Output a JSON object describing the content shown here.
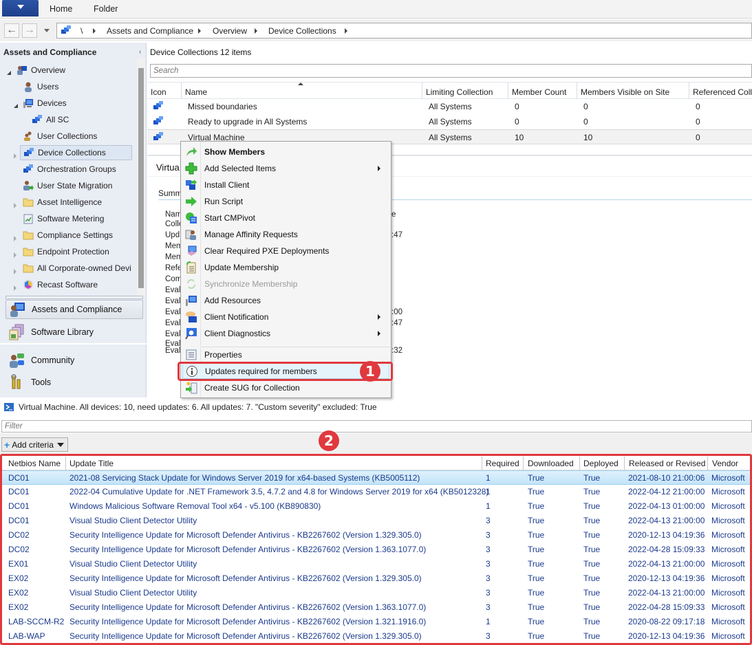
{
  "ribbon": {
    "tabs": [
      "Home",
      "Folder"
    ]
  },
  "address": {
    "crumbs": [
      "\\",
      "Assets and Compliance",
      "Overview",
      "Device Collections"
    ]
  },
  "left_panel": {
    "title": "Assets and Compliance",
    "tree": [
      {
        "label": "Overview",
        "icon": "overview-icon",
        "expander": "open"
      },
      {
        "label": "Users",
        "icon": "users-icon",
        "expander": "none"
      },
      {
        "label": "Devices",
        "icon": "devices-icon",
        "expander": "open"
      },
      {
        "label": "All SC",
        "icon": "device-collection-icon",
        "expander": "none"
      },
      {
        "label": "User Collections",
        "icon": "user-collections-icon",
        "expander": "none"
      },
      {
        "label": "Device Collections",
        "icon": "device-collection-icon",
        "expander": "closed",
        "selected": true
      },
      {
        "label": "Orchestration Groups",
        "icon": "device-collection-icon",
        "expander": "none"
      },
      {
        "label": "User State Migration",
        "icon": "user-state-migration-icon",
        "expander": "none"
      },
      {
        "label": "Asset Intelligence",
        "icon": "folder-icon",
        "expander": "closed"
      },
      {
        "label": "Software Metering",
        "icon": "software-metering-icon",
        "expander": "none"
      },
      {
        "label": "Compliance Settings",
        "icon": "folder-icon",
        "expander": "closed"
      },
      {
        "label": "Endpoint Protection",
        "icon": "folder-icon",
        "expander": "closed"
      },
      {
        "label": "All Corporate-owned Devi",
        "icon": "folder-icon",
        "expander": "closed"
      },
      {
        "label": "Recast Software",
        "icon": "recast-icon",
        "expander": "closed"
      }
    ],
    "workspaces": [
      {
        "label": "Assets and Compliance",
        "active": true
      },
      {
        "label": "Software Library"
      },
      {
        "label": "Community"
      },
      {
        "label": "Tools"
      }
    ]
  },
  "collections": {
    "title": "Device Collections 12 items",
    "search_placeholder": "Search",
    "columns": [
      "Icon",
      "Name",
      "Limiting Collection",
      "Member Count",
      "Members Visible on Site",
      "Referenced Colle"
    ],
    "rows": [
      {
        "name": "Missed boundaries",
        "limiting": "All Systems",
        "member_count": "0",
        "visible": "0",
        "referenced": "0"
      },
      {
        "name": "Ready to upgrade in All Systems",
        "limiting": "All Systems",
        "member_count": "0",
        "visible": "0",
        "referenced": "0"
      },
      {
        "name": "Virtual Machine",
        "limiting": "All Systems",
        "member_count": "10",
        "visible": "10",
        "referenced": "0",
        "selected": true
      }
    ]
  },
  "details": {
    "title": "Virtua",
    "summary_tab": "Summ",
    "labels": [
      "Nam",
      "Colle",
      "Upd",
      "Mem",
      "Mem",
      "Refe",
      "Com",
      "Evalu",
      "Evalu",
      "Evalu",
      "Evalu",
      "Evalu",
      "Evalu",
      "Evalu"
    ],
    "value_fragments": [
      "e",
      ":47",
      ":00",
      ":47",
      ":32"
    ]
  },
  "context_menu": {
    "items": [
      {
        "label": "Show Members",
        "icon": "show-members-icon",
        "bold": true
      },
      {
        "label": "Add Selected Items",
        "icon": "add-icon",
        "submenu": true
      },
      {
        "label": "Install Client",
        "icon": "install-client-icon"
      },
      {
        "label": "Run Script",
        "icon": "run-script-icon"
      },
      {
        "label": "Start CMPivot",
        "icon": "cmpivot-icon"
      },
      {
        "label": "Manage Affinity Requests",
        "icon": "affinity-icon"
      },
      {
        "label": "Clear Required PXE Deployments",
        "icon": "pxe-icon"
      },
      {
        "label": "Update Membership",
        "icon": "update-membership-icon"
      },
      {
        "label": "Synchronize Membership",
        "icon": "sync-icon",
        "disabled": true
      },
      {
        "label": "Add Resources",
        "icon": "add-resources-icon"
      },
      {
        "label": "Client Notification",
        "icon": "client-notification-icon",
        "submenu": true
      },
      {
        "label": "Client Diagnostics",
        "icon": "client-diagnostics-icon",
        "submenu": true
      },
      {
        "label": "Properties",
        "icon": "properties-icon"
      },
      {
        "label": "Updates required for members",
        "icon": "info-icon",
        "highlighted": true
      },
      {
        "label": "Create SUG for Collection",
        "icon": "create-sug-icon"
      }
    ]
  },
  "callouts": {
    "one": "1",
    "two": "2",
    "color": "#e0393e"
  },
  "results": {
    "status": "Virtual Machine. All devices: 10, need updates: 6. All updates: 7. \"Custom severity\" excluded: True",
    "filter_placeholder": "Filter",
    "add_criteria": "Add criteria",
    "columns": [
      "Netbios Name",
      "Update Title",
      "Required",
      "Downloaded",
      "Deployed",
      "Released or Revised",
      "Vendor"
    ],
    "rows": [
      {
        "netbios": "DC01",
        "title": "2021-08 Servicing Stack Update for Windows Server 2019 for x64-based Systems (KB5005112)",
        "required": "1",
        "downloaded": "True",
        "deployed": "True",
        "released": "2021-08-10 21:00:06",
        "vendor": "Microsoft",
        "selected": true
      },
      {
        "netbios": "DC01",
        "title": "2022-04 Cumulative Update for .NET Framework 3.5, 4.7.2 and 4.8 for Windows Server 2019 for x64 (KB5012328)",
        "required": "1",
        "downloaded": "True",
        "deployed": "True",
        "released": "2022-04-12 21:00:00",
        "vendor": "Microsoft"
      },
      {
        "netbios": "DC01",
        "title": "Windows Malicious Software Removal Tool x64 - v5.100 (KB890830)",
        "required": "1",
        "downloaded": "True",
        "deployed": "True",
        "released": "2022-04-13 01:00:00",
        "vendor": "Microsoft"
      },
      {
        "netbios": "DC01",
        "title": "Visual Studio Client Detector Utility",
        "required": "3",
        "downloaded": "True",
        "deployed": "True",
        "released": "2022-04-13 21:00:00",
        "vendor": "Microsoft"
      },
      {
        "netbios": "DC02",
        "title": "Security Intelligence Update for Microsoft Defender Antivirus - KB2267602 (Version 1.329.305.0)",
        "required": "3",
        "downloaded": "True",
        "deployed": "True",
        "released": "2020-12-13 04:19:36",
        "vendor": "Microsoft"
      },
      {
        "netbios": "DC02",
        "title": "Security Intelligence Update for Microsoft Defender Antivirus - KB2267602 (Version 1.363.1077.0)",
        "required": "3",
        "downloaded": "True",
        "deployed": "True",
        "released": "2022-04-28 15:09:33",
        "vendor": "Microsoft"
      },
      {
        "netbios": "EX01",
        "title": "Visual Studio Client Detector Utility",
        "required": "3",
        "downloaded": "True",
        "deployed": "True",
        "released": "2022-04-13 21:00:00",
        "vendor": "Microsoft"
      },
      {
        "netbios": "EX02",
        "title": "Security Intelligence Update for Microsoft Defender Antivirus - KB2267602 (Version 1.329.305.0)",
        "required": "3",
        "downloaded": "True",
        "deployed": "True",
        "released": "2020-12-13 04:19:36",
        "vendor": "Microsoft"
      },
      {
        "netbios": "EX02",
        "title": "Visual Studio Client Detector Utility",
        "required": "3",
        "downloaded": "True",
        "deployed": "True",
        "released": "2022-04-13 21:00:00",
        "vendor": "Microsoft"
      },
      {
        "netbios": "EX02",
        "title": "Security Intelligence Update for Microsoft Defender Antivirus - KB2267602 (Version 1.363.1077.0)",
        "required": "3",
        "downloaded": "True",
        "deployed": "True",
        "released": "2022-04-28 15:09:33",
        "vendor": "Microsoft"
      },
      {
        "netbios": "LAB-SCCM-R2",
        "title": "Security Intelligence Update for Microsoft Defender Antivirus - KB2267602 (Version 1.321.1916.0)",
        "required": "1",
        "downloaded": "True",
        "deployed": "True",
        "released": "2020-08-22 09:17:18",
        "vendor": "Microsoft"
      },
      {
        "netbios": "LAB-WAP",
        "title": "Security Intelligence Update for Microsoft Defender Antivirus - KB2267602 (Version 1.329.305.0)",
        "required": "3",
        "downloaded": "True",
        "deployed": "True",
        "released": "2020-12-13 04:19:36",
        "vendor": "Microsoft"
      }
    ]
  }
}
